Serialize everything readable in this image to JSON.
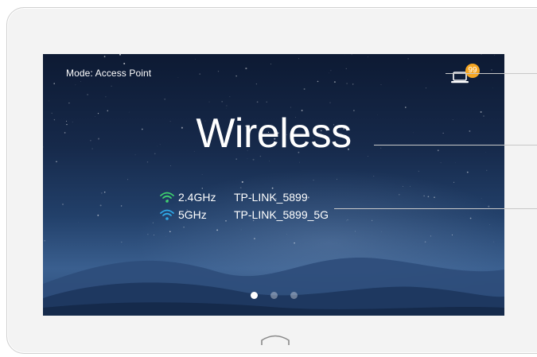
{
  "screen": {
    "mode_label": "Mode: Access Point",
    "device_count_badge": "99",
    "title": "Wireless",
    "networks": [
      {
        "band": "2.4GHz",
        "ssid": "TP-LINK_5899",
        "icon": "wifi-icon",
        "color": "#3ecf6e"
      },
      {
        "band": "5GHz",
        "ssid": "TP-LINK_5899_5G",
        "icon": "wifi-icon",
        "color": "#2fa8e6"
      }
    ],
    "pager": {
      "pages": 3,
      "active": 0
    }
  },
  "device": {
    "home_button_icon": "home-arch-icon"
  },
  "colors": {
    "badge": "#f5a623",
    "bezel": "#f3f3f3"
  }
}
